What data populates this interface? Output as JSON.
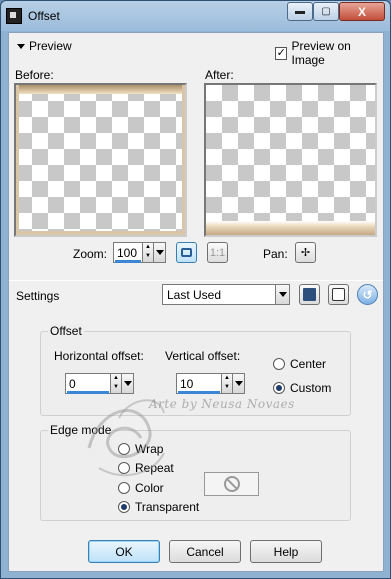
{
  "window": {
    "title": "Offset"
  },
  "title_buttons": {
    "minimize": "▬",
    "maximize": "▢",
    "close": "X"
  },
  "preview": {
    "toggle_label": "Preview",
    "preview_on_image_label": "Preview on Image",
    "preview_on_image_checked": "✓",
    "before_label": "Before:",
    "after_label": "After:"
  },
  "zoom": {
    "label": "Zoom:",
    "value": "100",
    "one_to_one": "1:1"
  },
  "pan": {
    "label": "Pan:",
    "icon": "✢"
  },
  "settings": {
    "label": "Settings",
    "preset": "Last Used"
  },
  "offset": {
    "group_title": "Offset",
    "horizontal_label": "Horizontal offset:",
    "horizontal_value": "0",
    "vertical_label": "Vertical offset:",
    "vertical_value": "10",
    "center_label": "Center",
    "custom_label": "Custom",
    "selected": "Custom"
  },
  "edge_mode": {
    "group_title": "Edge mode",
    "options": [
      "Wrap",
      "Repeat",
      "Color",
      "Transparent"
    ],
    "selected": "Transparent"
  },
  "watermark": {
    "text": "Arte by Neusa Novaes"
  },
  "footer": {
    "ok": "OK",
    "cancel": "Cancel",
    "help": "Help"
  },
  "colors": {
    "title_bar": "#9cbcdb",
    "close_button": "#c24e3a",
    "accent": "#3b87d6"
  }
}
